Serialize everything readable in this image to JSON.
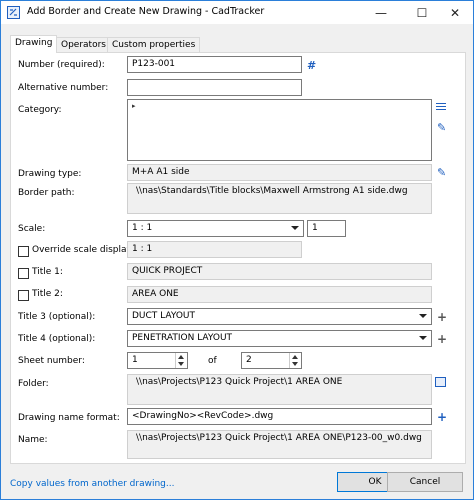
{
  "window": {
    "title": "Add Border and Create New Drawing - CadTracker"
  },
  "tabs": [
    "Drawing",
    "Operators",
    "Custom properties"
  ],
  "form": {
    "number_label": "Number (required):",
    "number_value": "P123-001",
    "alt_number_label": "Alternative number:",
    "alt_number_value": "",
    "category_label": "Category:",
    "drawing_type_label": "Drawing type:",
    "drawing_type_value": "M+A A1 side",
    "border_path_label": "Border path:",
    "border_path_value": "\\\\nas\\Standards\\Title blocks\\Maxwell Armstrong A1 side.dwg",
    "scale_label": "Scale:",
    "scale_value": "1 : 1",
    "scale_factor": "1",
    "override_scale_label": "Override scale display:",
    "override_scale_value": "1 : 1",
    "title1_label": "Title 1:",
    "title1_value": "QUICK PROJECT",
    "title2_label": "Title 2:",
    "title2_value": "AREA ONE",
    "title3_label": "Title 3 (optional):",
    "title3_value": "DUCT LAYOUT",
    "title4_label": "Title 4 (optional):",
    "title4_value": "PENETRATION LAYOUT",
    "sheet_label": "Sheet number:",
    "sheet_value": "1",
    "of_label": "of",
    "sheet_total": "2",
    "folder_label": "Folder:",
    "folder_value": "\\\\nas\\Projects\\P123 Quick Project\\1 AREA ONE",
    "name_format_label": "Drawing name format:",
    "name_format_value": "<DrawingNo><RevCode>.dwg",
    "name_label": "Name:",
    "name_value": "\\\\nas\\Projects\\P123 Quick Project\\1 AREA ONE\\P123-00_w0.dwg"
  },
  "footer": {
    "copy_link": "Copy values from another drawing...",
    "ok": "OK",
    "cancel": "Cancel"
  },
  "icons": {
    "hash": "#",
    "minimize": "—",
    "maximize": "☐",
    "close": "✕",
    "pencil": "✎",
    "plus": "+",
    "tree_arrow": "▸"
  },
  "colors": {
    "accent": "#0078d7",
    "link": "#0066cc",
    "icon_blue": "#1f5fbf"
  }
}
